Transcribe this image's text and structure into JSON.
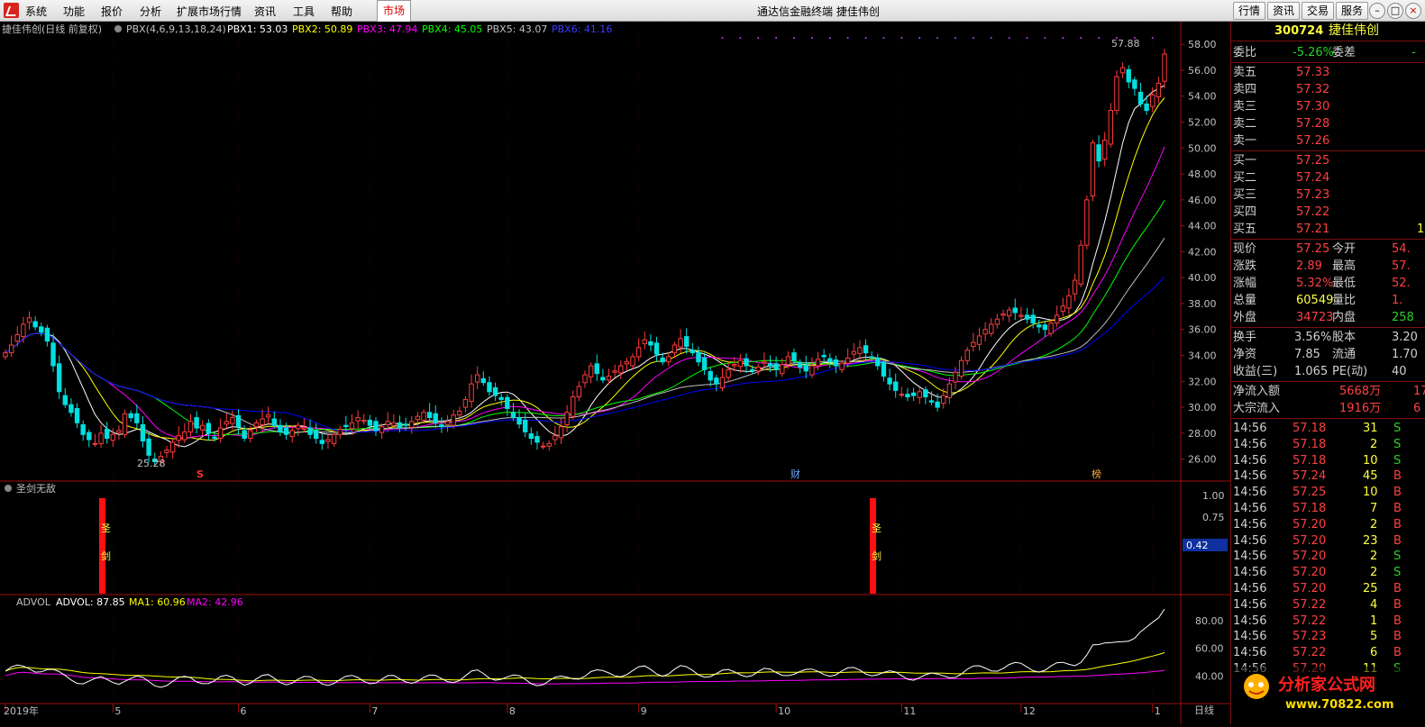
{
  "menu": {
    "items": [
      "系统",
      "功能",
      "报价",
      "分析",
      "扩展市场行情",
      "资讯",
      "工具",
      "帮助"
    ],
    "market": "市场"
  },
  "window": {
    "title": "通达信金融终端 捷佳伟创"
  },
  "toolbar": {
    "buttons": [
      "行情",
      "资讯",
      "交易",
      "服务"
    ]
  },
  "main_panel": {
    "name": "捷佳伟创(日线 前复权)",
    "indicator": "PBX(4,6,9,13,18,24)",
    "pbx": [
      {
        "label": "PBX1: 53.03",
        "color": "#ffffff"
      },
      {
        "label": "PBX2: 50.89",
        "color": "#ffff00"
      },
      {
        "label": "PBX3: 47.94",
        "color": "#ff00ff"
      },
      {
        "label": "PBX4: 45.05",
        "color": "#00ff00"
      },
      {
        "label": "PBX5: 43.07",
        "color": "#c0c0c0"
      },
      {
        "label": "PBX6: 41.16",
        "color": "#0000ff"
      }
    ],
    "high_label": "57.88",
    "low_label": "25.28",
    "y_ticks": [
      "58.00",
      "56.00",
      "54.00",
      "52.00",
      "50.00",
      "48.00",
      "46.00",
      "44.00",
      "42.00",
      "40.00",
      "38.00",
      "36.00",
      "34.00",
      "32.00",
      "30.00",
      "28.00",
      "26.00"
    ],
    "markers": [
      {
        "text": "S",
        "color": "#ff3030"
      },
      {
        "text": "财",
        "color": "#6aa8ff"
      },
      {
        "text": "榜",
        "color": "#ffaa40"
      }
    ]
  },
  "sub1": {
    "title": "圣剑无敌",
    "y_ticks": [
      "1.00",
      "0.75"
    ],
    "current": "0.42",
    "signal_text": [
      "圣",
      "剑"
    ]
  },
  "sub2": {
    "title": "ADVOL",
    "values": [
      {
        "label": "ADVOL: 87.85",
        "color": "#ffffff"
      },
      {
        "label": "MA1: 60.96",
        "color": "#ffff00"
      },
      {
        "label": "MA2: 42.96",
        "color": "#ff00ff"
      }
    ],
    "y_ticks": [
      "80.00",
      "60.00",
      "40.00"
    ]
  },
  "x_axis": {
    "labels": [
      "2019年",
      "5",
      "6",
      "7",
      "8",
      "9",
      "10",
      "11",
      "12",
      "1"
    ],
    "period": "日线"
  },
  "chart_data": {
    "type": "candlestick",
    "ylim": [
      25,
      58.5
    ],
    "closes": [
      34.2,
      34.8,
      35.6,
      36.4,
      36.9,
      36.2,
      35.8,
      35.1,
      33.2,
      31.2,
      30.2,
      29.6,
      28.8,
      27.9,
      27.5,
      27.2,
      28.0,
      27.6,
      27.9,
      28.2,
      29.5,
      29.2,
      28.8,
      27.4,
      26.3,
      25.8,
      26.2,
      26.7,
      27.3,
      27.8,
      28.1,
      28.9,
      28.4,
      28.6,
      28.0,
      27.6,
      28.4,
      28.9,
      29.2,
      28.5,
      27.6,
      28.2,
      28.8,
      29.1,
      29.4,
      28.6,
      28.1,
      27.9,
      28.2,
      28.6,
      28.4,
      27.9,
      27.6,
      27.2,
      27.5,
      27.9,
      28.3,
      28.5,
      28.8,
      29.2,
      29.0,
      28.6,
      28.2,
      28.5,
      28.9,
      28.8,
      28.4,
      28.6,
      28.9,
      29.3,
      29.6,
      29.2,
      28.8,
      28.5,
      28.9,
      29.4,
      29.7,
      30.6,
      31.8,
      32.5,
      31.9,
      31.2,
      30.9,
      30.6,
      29.9,
      29.2,
      28.7,
      28.1,
      27.6,
      27.3,
      27.0,
      27.2,
      27.8,
      28.5,
      29.6,
      30.8,
      31.6,
      32.5,
      33.2,
      32.6,
      32.1,
      32.4,
      32.8,
      33.2,
      33.5,
      33.9,
      34.6,
      35.2,
      34.8,
      34.1,
      33.5,
      33.9,
      34.8,
      35.3,
      34.7,
      34.2,
      33.5,
      32.9,
      32.1,
      31.8,
      32.3,
      32.9,
      33.3,
      33.6,
      33.2,
      32.8,
      33.1,
      33.5,
      33.2,
      32.9,
      33.3,
      33.9,
      33.6,
      33.1,
      32.8,
      33.2,
      33.7,
      33.9,
      33.5,
      33.2,
      33.4,
      33.8,
      34.3,
      34.6,
      34.2,
      33.8,
      33.2,
      32.4,
      31.8,
      31.3,
      31.0,
      30.8,
      30.9,
      31.2,
      30.8,
      30.4,
      30.0,
      30.9,
      31.8,
      32.7,
      33.6,
      34.4,
      35.0,
      35.5,
      36.0,
      36.4,
      36.8,
      37.2,
      37.5,
      37.3,
      37.1,
      36.8,
      36.5,
      36.2,
      36.0,
      36.5,
      37.1,
      37.8,
      38.6,
      39.8,
      42.5,
      46.0,
      50.4,
      49.0,
      50.6,
      52.9,
      55.5,
      56.2,
      55.1,
      54.6,
      53.4,
      52.9,
      54.1,
      55.0,
      57.25
    ],
    "series_names": [
      "PBX1",
      "PBX2",
      "PBX3",
      "PBX4",
      "PBX5",
      "PBX6"
    ],
    "sub1_signals": [
      0.42,
      1.0,
      1.0
    ],
    "advol_last": [
      87.85,
      60.96,
      42.96
    ]
  },
  "quote": {
    "code": "300724",
    "name": "捷佳伟创",
    "weibi": {
      "label": "委比",
      "value": "-5.26%",
      "label2": "委差",
      "value2": "-"
    },
    "sells": [
      {
        "label": "卖五",
        "price": "57.33"
      },
      {
        "label": "卖四",
        "price": "57.32"
      },
      {
        "label": "卖三",
        "price": "57.30"
      },
      {
        "label": "卖二",
        "price": "57.28"
      },
      {
        "label": "卖一",
        "price": "57.26"
      }
    ],
    "buys": [
      {
        "label": "买一",
        "price": "57.25"
      },
      {
        "label": "买二",
        "price": "57.24"
      },
      {
        "label": "买三",
        "price": "57.23"
      },
      {
        "label": "买四",
        "price": "57.22"
      },
      {
        "label": "买五",
        "price": "57.21",
        "vol": "1"
      }
    ],
    "stats": [
      {
        "l1": "现价",
        "v1": "57.25",
        "c1": "r",
        "l2": "今开",
        "v2": "54.",
        "c2": "r"
      },
      {
        "l1": "涨跌",
        "v1": "2.89",
        "c1": "r",
        "l2": "最高",
        "v2": "57.",
        "c2": "r"
      },
      {
        "l1": "涨幅",
        "v1": "5.32%",
        "c1": "r",
        "l2": "最低",
        "v2": "52.",
        "c2": "r"
      },
      {
        "l1": "总量",
        "v1": "60549",
        "c1": "y",
        "l2": "量比",
        "v2": "1.",
        "c2": "r"
      },
      {
        "l1": "外盘",
        "v1": "34723",
        "c1": "r",
        "l2": "内盘",
        "v2": "258",
        "c2": "g"
      }
    ],
    "stats2": [
      {
        "l1": "换手",
        "v1": "3.56%",
        "c1": "w",
        "l2": "股本",
        "v2": "3.20",
        "c2": "w"
      },
      {
        "l1": "净资",
        "v1": "7.85",
        "c1": "w",
        "l2": "流通",
        "v2": "1.70",
        "c2": "w"
      },
      {
        "l1": "收益(三)",
        "v1": "1.065",
        "c1": "w",
        "l2": "PE(动)",
        "v2": "40",
        "c2": "w"
      }
    ],
    "flows": [
      {
        "label": "净流入额",
        "value": "5668万",
        "extra": "17"
      },
      {
        "label": "大宗流入",
        "value": "1916万",
        "extra": "6"
      }
    ],
    "ticks": [
      {
        "t": "14:56",
        "p": "57.18",
        "v": "31",
        "s": "S"
      },
      {
        "t": "14:56",
        "p": "57.18",
        "v": "2",
        "s": "S"
      },
      {
        "t": "14:56",
        "p": "57.18",
        "v": "10",
        "s": "S"
      },
      {
        "t": "14:56",
        "p": "57.24",
        "v": "45",
        "s": "B"
      },
      {
        "t": "14:56",
        "p": "57.25",
        "v": "10",
        "s": "B"
      },
      {
        "t": "14:56",
        "p": "57.18",
        "v": "7",
        "s": "B"
      },
      {
        "t": "14:56",
        "p": "57.20",
        "v": "2",
        "s": "B"
      },
      {
        "t": "14:56",
        "p": "57.20",
        "v": "23",
        "s": "B"
      },
      {
        "t": "14:56",
        "p": "57.20",
        "v": "2",
        "s": "S"
      },
      {
        "t": "14:56",
        "p": "57.20",
        "v": "2",
        "s": "S"
      },
      {
        "t": "14:56",
        "p": "57.20",
        "v": "25",
        "s": "B"
      },
      {
        "t": "14:56",
        "p": "57.22",
        "v": "4",
        "s": "B"
      },
      {
        "t": "14:56",
        "p": "57.22",
        "v": "1",
        "s": "B"
      },
      {
        "t": "14:56",
        "p": "57.23",
        "v": "5",
        "s": "B"
      },
      {
        "t": "14:56",
        "p": "57.22",
        "v": "6",
        "s": "B"
      },
      {
        "t": "14:56",
        "p": "57.20",
        "v": "11",
        "s": "S"
      }
    ]
  },
  "watermark": {
    "text": "分析家公式网",
    "url": "www.70822.com"
  }
}
